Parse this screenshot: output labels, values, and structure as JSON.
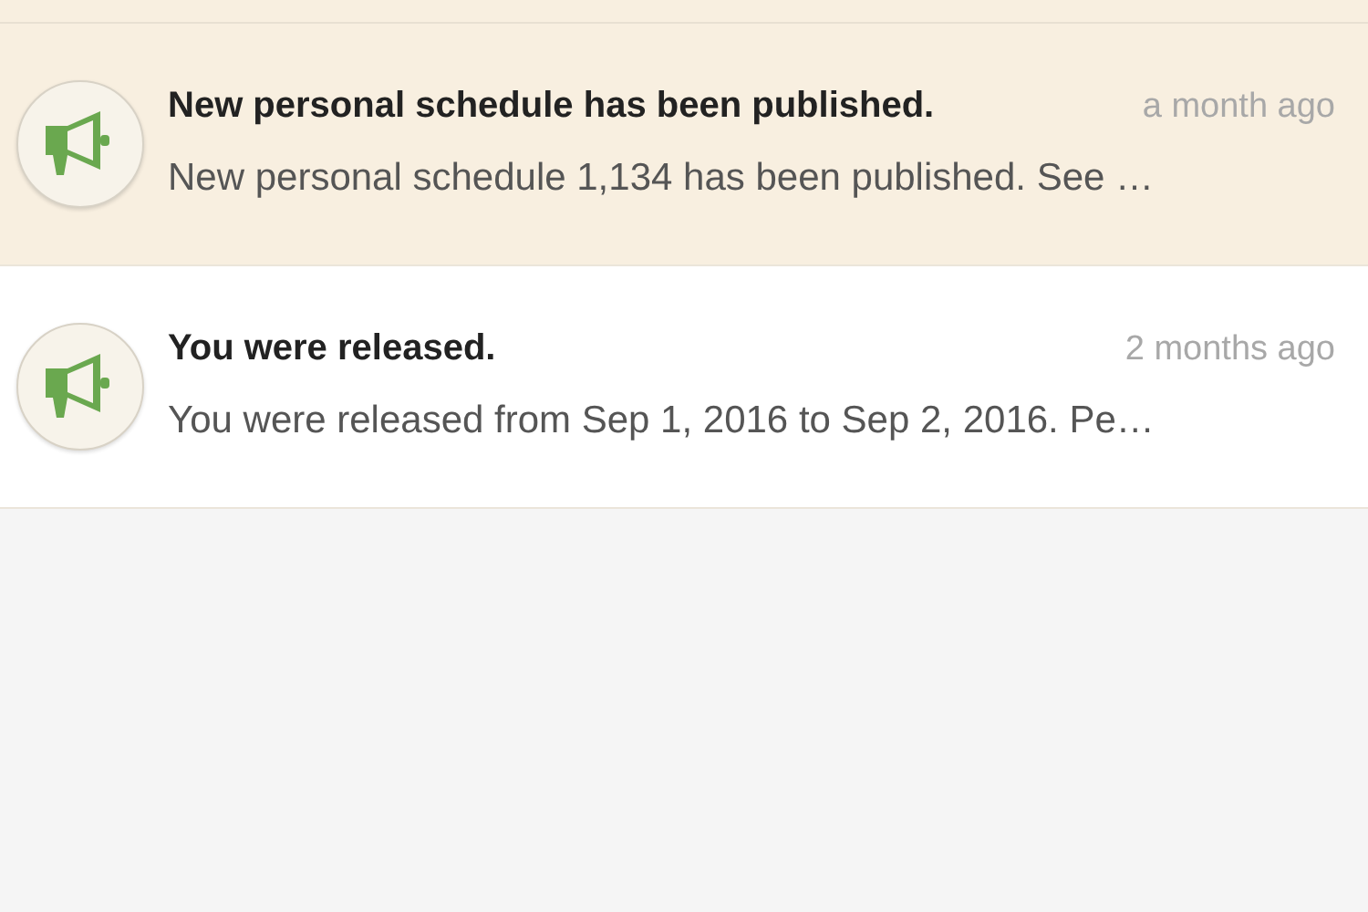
{
  "notifications": [
    {
      "title": "New personal schedule has been published.",
      "time": "a month ago",
      "body": "New personal schedule 1,134 has been published. See …",
      "unread": true
    },
    {
      "title": "You were released.",
      "time": "2 months ago",
      "body": "You were released from Sep 1, 2016 to Sep 2, 2016. Pe…",
      "unread": false
    }
  ]
}
